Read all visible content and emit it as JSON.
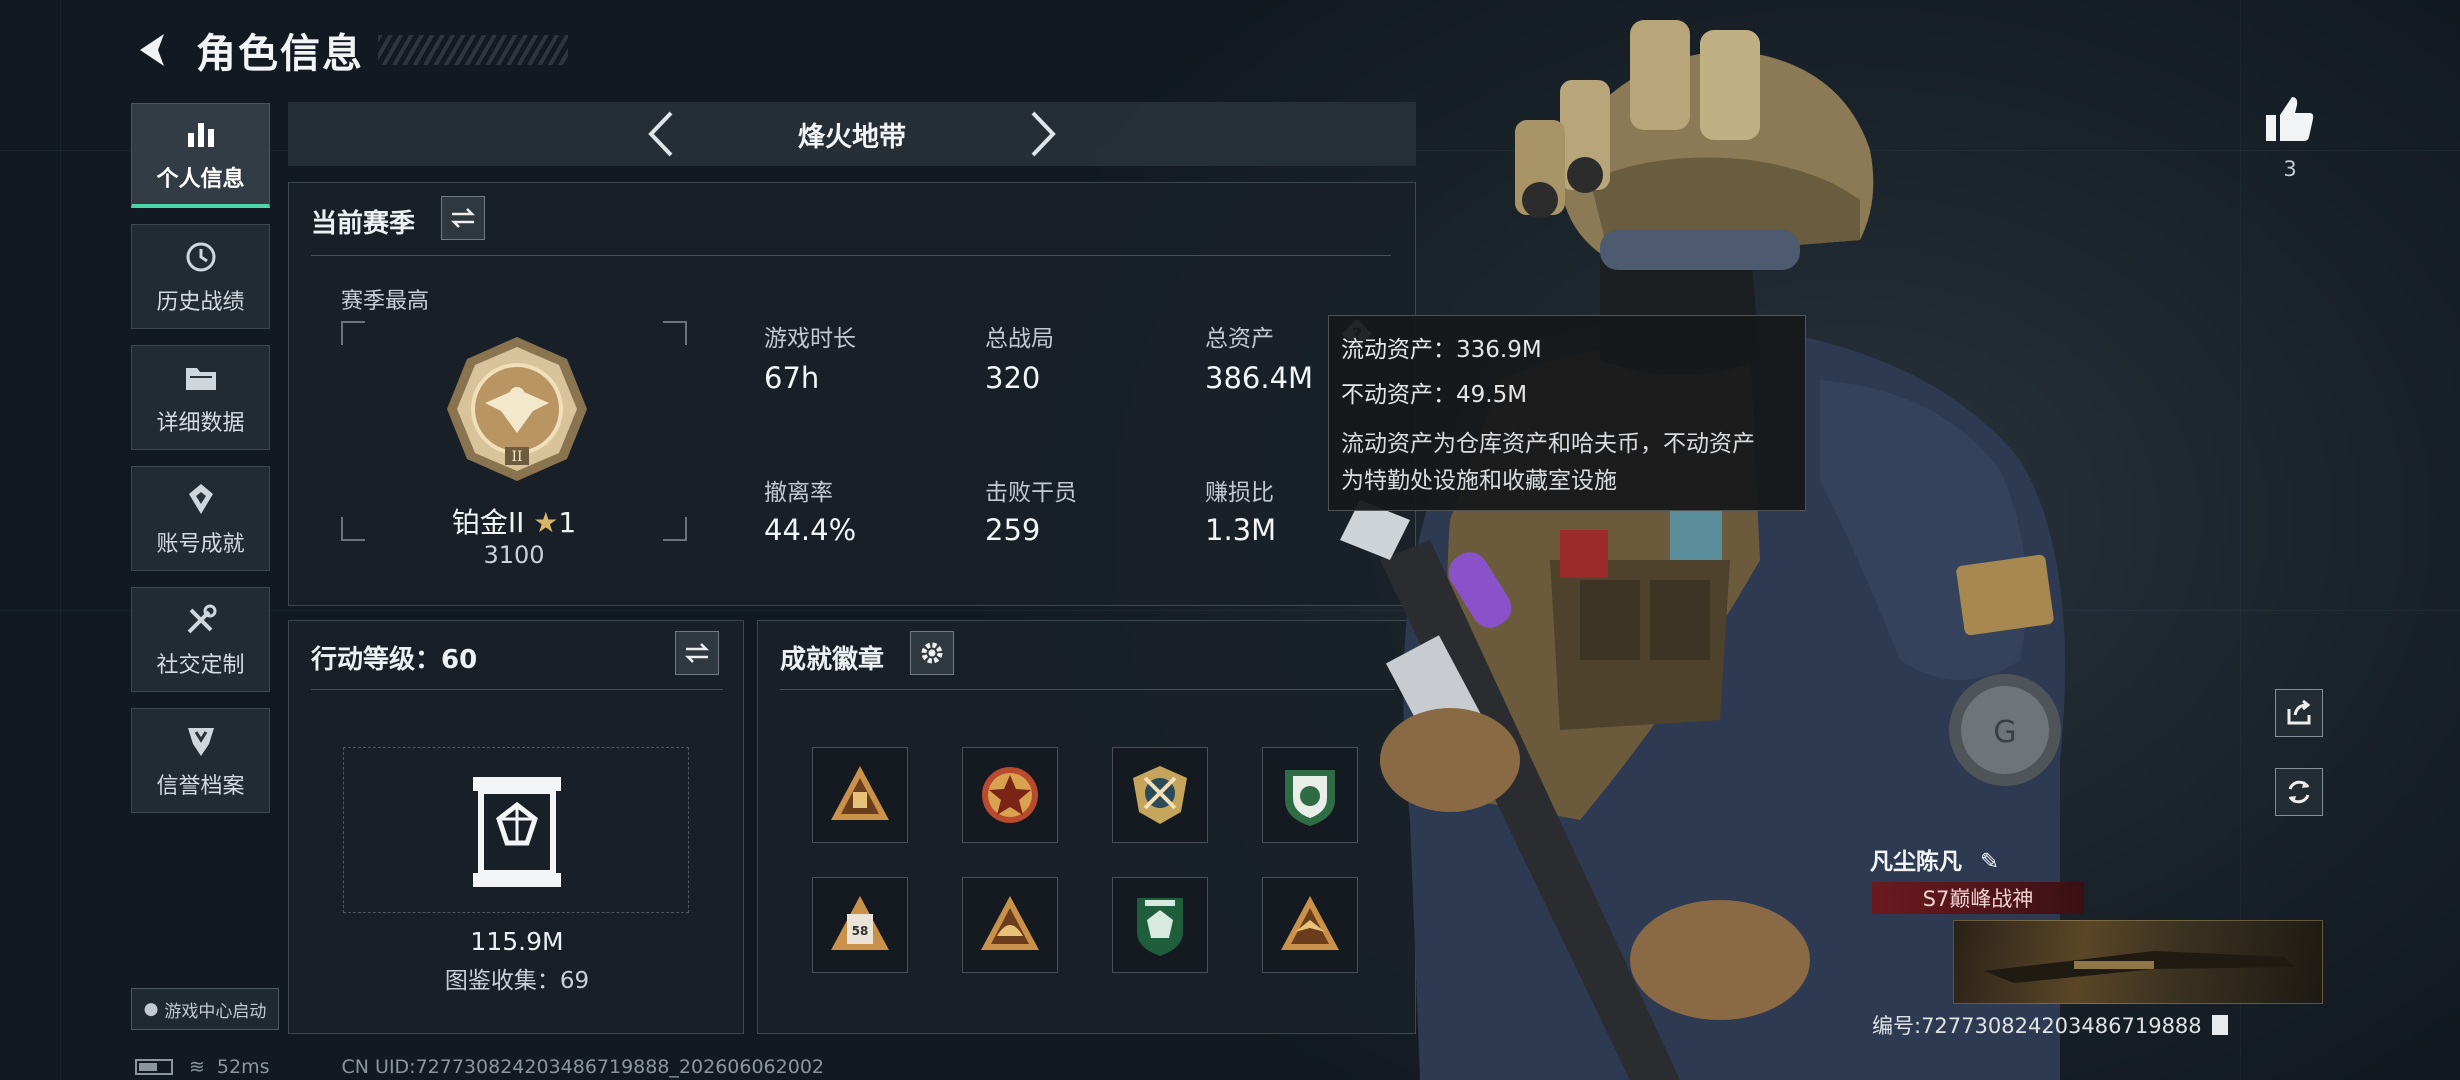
{
  "header": {
    "title": "角色信息"
  },
  "nav": {
    "items": [
      {
        "label": "个人信息",
        "icon": "bar-chart-icon",
        "active": true
      },
      {
        "label": "历史战绩",
        "icon": "history-icon",
        "active": false
      },
      {
        "label": "详细数据",
        "icon": "folder-icon",
        "active": false
      },
      {
        "label": "账号成就",
        "icon": "achievement-icon",
        "active": false
      },
      {
        "label": "社交定制",
        "icon": "tools-icon",
        "active": false
      },
      {
        "label": "信誉档案",
        "icon": "shield-icon",
        "active": false
      }
    ],
    "game_center": "游戏中心启动"
  },
  "status": {
    "ping": "52ms",
    "uid_line": "CN UID:727730824203486719888_202606062002"
  },
  "mode": {
    "name": "烽火地带"
  },
  "season": {
    "title": "当前赛季",
    "best_label": "赛季最高",
    "rank_name": "铂金II",
    "rank_stars": "1",
    "rank_score": "3100",
    "stats": [
      {
        "label": "游戏时长",
        "value": "67h"
      },
      {
        "label": "总战局",
        "value": "320"
      },
      {
        "label": "总资产",
        "value": "386.4M"
      },
      {
        "label": "撤离率",
        "value": "44.4%"
      },
      {
        "label": "击败干员",
        "value": "259"
      },
      {
        "label": "赚损比",
        "value": "1.3M"
      }
    ]
  },
  "tooltip": {
    "liquid": "流动资产：336.9M",
    "fixed": "不动资产：49.5M",
    "desc_line1": "流动资产为仓库资产和哈夫币，不动资产",
    "desc_line2": "为特勤处设施和收藏室设施"
  },
  "action_level": {
    "title": "行动等级：60",
    "value": "115.9M",
    "collection": "图鉴收集：69"
  },
  "badges": {
    "title": "成就徽章",
    "items": [
      "badge-1",
      "badge-2",
      "badge-3",
      "badge-4",
      "badge-5",
      "badge-6",
      "badge-7",
      "badge-8"
    ]
  },
  "player": {
    "likes": "3",
    "name": "凡尘陈凡",
    "title_tag": "S7巅峰战神",
    "id_line": "编号:727730824203486719888"
  },
  "colors": {
    "accent": "#4ed6a8",
    "gold": "#c9a86a",
    "title_tag": "#6a1a1f"
  }
}
